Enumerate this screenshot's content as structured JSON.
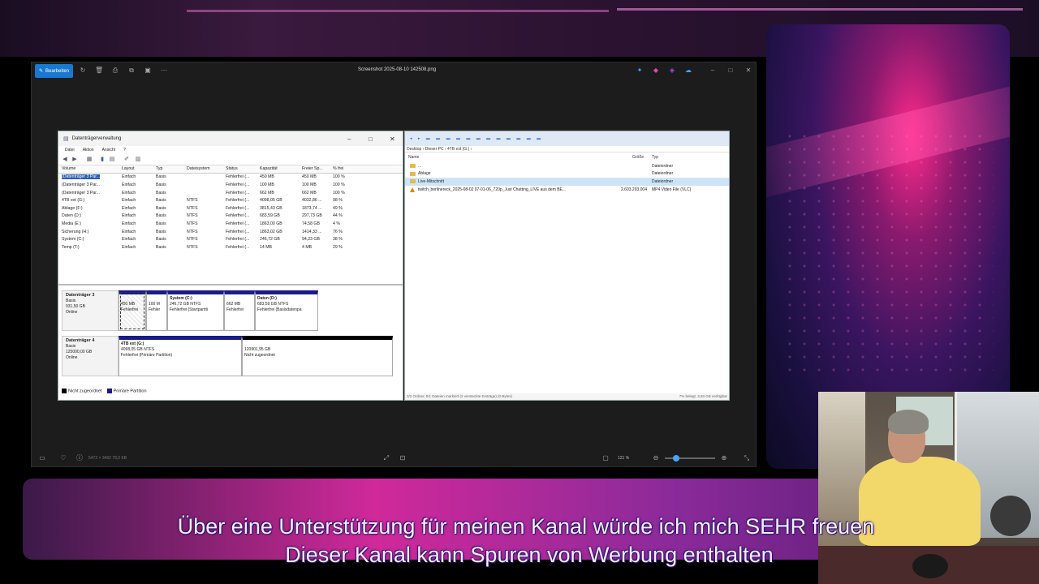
{
  "viewer": {
    "edit_label": "Bearbeiten",
    "title": "Screenshot 2025-08-10 142508.png",
    "bottom_info": "5472 × 3492   78,0 KB",
    "zoom": "121 %"
  },
  "disk_mgmt": {
    "title": "Datenträgerverwaltung",
    "menu": [
      "Datei",
      "Aktion",
      "Ansicht",
      "?"
    ],
    "columns": [
      "Volume",
      "Layout",
      "Typ",
      "Dateisystem",
      "Status",
      "Kapazität",
      "Freier Sp...",
      "% frei"
    ],
    "rows": [
      [
        "(Datenträger 3 Par...",
        "Einfach",
        "Basis",
        "",
        "Fehlerfrei (...",
        "450 MB",
        "450 MB",
        "100 %"
      ],
      [
        "(Datenträger 3 Par...",
        "Einfach",
        "Basis",
        "",
        "Fehlerfrei (...",
        "100 MB",
        "100 MB",
        "100 %"
      ],
      [
        "(Datenträger 3 Par...",
        "Einfach",
        "Basis",
        "",
        "Fehlerfrei (...",
        "662 MB",
        "662 MB",
        "100 %"
      ],
      [
        "4TB ext (G:)",
        "Einfach",
        "Basis",
        "NTFS",
        "Fehlerfrei (...",
        "4098,05 GB",
        "4032,86 ...",
        "98 %"
      ],
      [
        "Ablage (F:)",
        "Einfach",
        "Basis",
        "NTFS",
        "Fehlerfrei (...",
        "3815,43 GB",
        "1873,74 ...",
        "49 %"
      ],
      [
        "Daten (D:)",
        "Einfach",
        "Basis",
        "NTFS",
        "Fehlerfrei (...",
        "683,59 GB",
        "297,73 GB",
        "44 %"
      ],
      [
        "Media (E:)",
        "Einfach",
        "Basis",
        "NTFS",
        "Fehlerfrei (...",
        "1863,00 GB",
        "74,58 GB",
        "4 %"
      ],
      [
        "Sicherung (H:)",
        "Einfach",
        "Basis",
        "NTFS",
        "Fehlerfrei (...",
        "1863,02 GB",
        "1414,33 ...",
        "76 %"
      ],
      [
        "System (C:)",
        "Einfach",
        "Basis",
        "NTFS",
        "Fehlerfrei (...",
        "246,72 GB",
        "94,23 GB",
        "38 %"
      ],
      [
        "Temp (T:)",
        "Einfach",
        "Basis",
        "NTFS",
        "Fehlerfrei (...",
        "14 MB",
        "4 MB",
        "29 %"
      ]
    ],
    "disk3": {
      "name": "Datenträger 3",
      "info": [
        "Basis",
        "931,50 GB",
        "Online"
      ],
      "parts": [
        {
          "title": "",
          "lines": [
            "450 MB",
            "Fehlerfrei"
          ]
        },
        {
          "title": "",
          "lines": [
            "100 M",
            "Fehler"
          ]
        },
        {
          "title": "System (C:)",
          "lines": [
            "246,72 GB NTFS",
            "Fehlerfrei (Startpartiti"
          ]
        },
        {
          "title": "",
          "lines": [
            "662 MB",
            "Fehlerfrei"
          ]
        },
        {
          "title": "Daten (D:)",
          "lines": [
            "683,59 GB NTFS",
            "Fehlerfrei (Basisdatenpa"
          ]
        }
      ]
    },
    "disk4": {
      "name": "Datenträger 4",
      "info": [
        "Basis",
        "125000,00 GB",
        "Online"
      ],
      "parts": [
        {
          "title": "4TB ext (G:)",
          "lines": [
            "4098,05 GB NTFS",
            "Fehlerfrei (Primäre Partition)"
          ]
        },
        {
          "title": "",
          "lines": [
            "120901,95 GB",
            "Nicht zugeordnet"
          ]
        }
      ]
    },
    "legend": [
      "Nicht zugeordnet",
      "Primäre Partition"
    ]
  },
  "explorer": {
    "path": "Desktop  ›  Dieser PC  ›  4TB ext (G:)  ›",
    "columns": [
      "Name",
      "Größe",
      "Typ"
    ],
    "rows": [
      {
        "name": "...",
        "size": "",
        "type": "Dateiordner",
        "kind": "folder"
      },
      {
        "name": "Ablage",
        "size": "",
        "type": "Dateiordner",
        "kind": "folder"
      },
      {
        "name": "Live-Mitschnitt",
        "size": "",
        "type": "Dateiordner",
        "kind": "folder"
      },
      {
        "name": "twitch_berlinereck_2025-08-02 07-01-06_720p_Just Chatting_LIVE aus dem BE...",
        "size": "2.603.203.004",
        "type": "MP4 Video File (VLC)",
        "kind": "video"
      }
    ],
    "status_left": "3/2 Ordner, 0/1 Dateien markiert (2 versteckte Einträge) (0 Bytes)",
    "status_right": "7% belegt, 3,93 GB verfügbar"
  },
  "subtitles": {
    "line1": "Über eine Unterstützung für meinen Kanal würde ich mich SEHR freuen",
    "line2": "Dieser Kanal kann Spuren von Werbung enthalten"
  },
  "colors": {
    "accent": "#1a78d2",
    "partition": "#1a1a8a",
    "subtitle": "#f4efff"
  }
}
